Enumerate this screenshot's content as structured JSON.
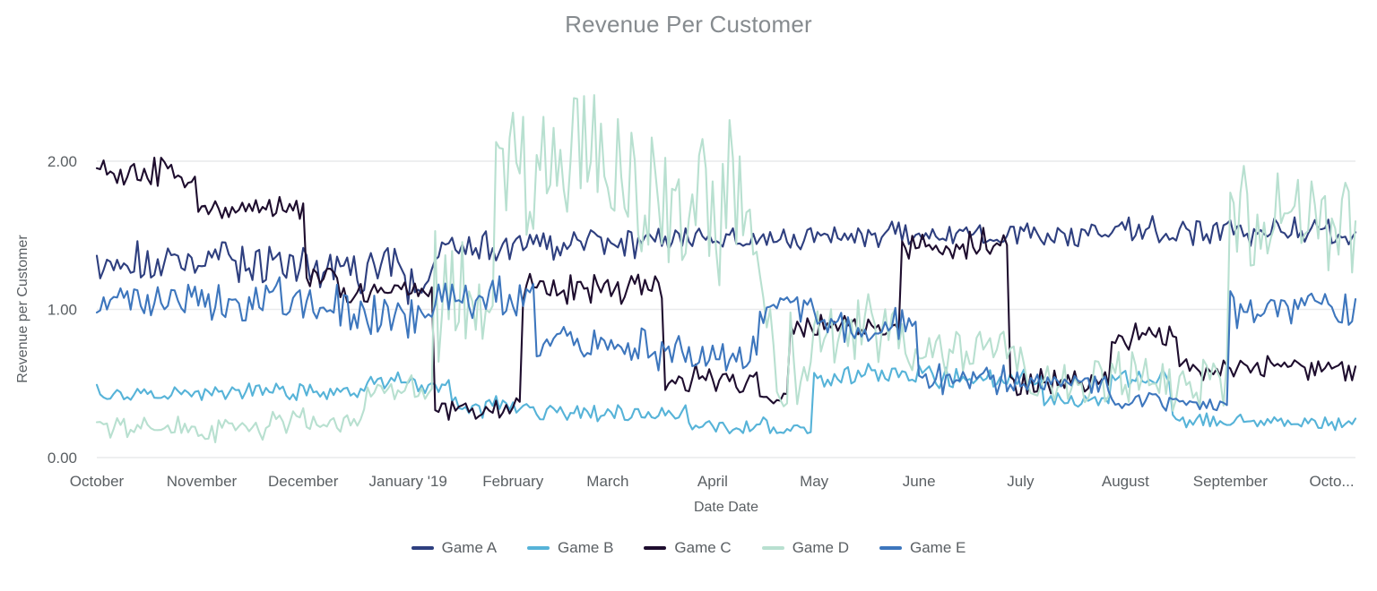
{
  "chart_data": {
    "type": "line",
    "title": "Revenue Per Customer",
    "xlabel": "Date Date",
    "ylabel": "Revenue per Customer",
    "grid": true,
    "legend_position": "bottom",
    "ylim": [
      0.0,
      2.8
    ],
    "yticks": [
      0.0,
      1.0,
      2.0
    ],
    "ytick_labels": [
      "0.00",
      "1.00",
      "2.00"
    ],
    "x_tick_labels": [
      "October",
      "November",
      "December",
      "January '19",
      "February",
      "March",
      "April",
      "May",
      "June",
      "July",
      "August",
      "September",
      "Octo..."
    ],
    "x_tick_positions": [
      0,
      31,
      61,
      92,
      123,
      151,
      182,
      212,
      243,
      273,
      304,
      335,
      365
    ],
    "x_range_days": [
      0,
      372
    ],
    "n_points": 373,
    "series": [
      {
        "name": "Game A",
        "color": "#2e3f7f",
        "segments": [
          {
            "from": 0,
            "to": 30,
            "level": 1.3,
            "noise": 0.11
          },
          {
            "from": 30,
            "to": 62,
            "level": 1.32,
            "noise": 0.11
          },
          {
            "from": 62,
            "to": 92,
            "level": 1.26,
            "noise": 0.12
          },
          {
            "from": 92,
            "to": 100,
            "level": 1.18,
            "noise": 0.1
          },
          {
            "from": 100,
            "to": 122,
            "level": 1.42,
            "noise": 0.09
          },
          {
            "from": 122,
            "to": 160,
            "level": 1.44,
            "noise": 0.08
          },
          {
            "from": 160,
            "to": 210,
            "level": 1.48,
            "noise": 0.07
          },
          {
            "from": 210,
            "to": 250,
            "level": 1.5,
            "noise": 0.07
          },
          {
            "from": 250,
            "to": 300,
            "level": 1.5,
            "noise": 0.07
          },
          {
            "from": 300,
            "to": 340,
            "level": 1.53,
            "noise": 0.07
          },
          {
            "from": 340,
            "to": 373,
            "level": 1.52,
            "noise": 0.07
          }
        ]
      },
      {
        "name": "Game B",
        "color": "#56b3d8",
        "segments": [
          {
            "from": 0,
            "to": 45,
            "level": 0.44,
            "noise": 0.05
          },
          {
            "from": 45,
            "to": 80,
            "level": 0.45,
            "noise": 0.05
          },
          {
            "from": 80,
            "to": 95,
            "level": 0.52,
            "noise": 0.05
          },
          {
            "from": 95,
            "to": 105,
            "level": 0.47,
            "noise": 0.05
          },
          {
            "from": 105,
            "to": 130,
            "level": 0.34,
            "noise": 0.05
          },
          {
            "from": 130,
            "to": 175,
            "level": 0.3,
            "noise": 0.05
          },
          {
            "from": 175,
            "to": 200,
            "level": 0.22,
            "noise": 0.04
          },
          {
            "from": 200,
            "to": 212,
            "level": 0.19,
            "noise": 0.03
          },
          {
            "from": 212,
            "to": 245,
            "level": 0.55,
            "noise": 0.07
          },
          {
            "from": 245,
            "to": 280,
            "level": 0.53,
            "noise": 0.06
          },
          {
            "from": 280,
            "to": 300,
            "level": 0.38,
            "noise": 0.05
          },
          {
            "from": 300,
            "to": 318,
            "level": 0.55,
            "noise": 0.05
          },
          {
            "from": 318,
            "to": 373,
            "level": 0.24,
            "noise": 0.04
          }
        ]
      },
      {
        "name": "Game C",
        "color": "#1e0d2e",
        "segments": [
          {
            "from": 0,
            "to": 30,
            "level": 1.92,
            "noise": 0.09
          },
          {
            "from": 30,
            "to": 62,
            "level": 1.68,
            "noise": 0.08
          },
          {
            "from": 62,
            "to": 72,
            "level": 1.22,
            "noise": 0.07
          },
          {
            "from": 72,
            "to": 100,
            "level": 1.12,
            "noise": 0.07
          },
          {
            "from": 100,
            "to": 126,
            "level": 0.33,
            "noise": 0.06
          },
          {
            "from": 126,
            "to": 168,
            "level": 1.15,
            "noise": 0.08
          },
          {
            "from": 168,
            "to": 196,
            "level": 0.52,
            "noise": 0.08
          },
          {
            "from": 196,
            "to": 205,
            "level": 0.4,
            "noise": 0.05
          },
          {
            "from": 205,
            "to": 238,
            "level": 0.88,
            "noise": 0.07
          },
          {
            "from": 238,
            "to": 270,
            "level": 1.43,
            "noise": 0.08
          },
          {
            "from": 270,
            "to": 300,
            "level": 0.52,
            "noise": 0.07
          },
          {
            "from": 300,
            "to": 320,
            "level": 0.82,
            "noise": 0.08
          },
          {
            "from": 320,
            "to": 373,
            "level": 0.6,
            "noise": 0.06
          }
        ]
      },
      {
        "name": "Game D",
        "color": "#b8e0d0",
        "segments": [
          {
            "from": 0,
            "to": 50,
            "level": 0.19,
            "noise": 0.06
          },
          {
            "from": 50,
            "to": 80,
            "level": 0.24,
            "noise": 0.07
          },
          {
            "from": 80,
            "to": 100,
            "level": 0.45,
            "noise": 0.08
          },
          {
            "from": 100,
            "to": 118,
            "level": 1.1,
            "noise": 0.35
          },
          {
            "from": 118,
            "to": 160,
            "level": 2.0,
            "noise": 0.42
          },
          {
            "from": 160,
            "to": 196,
            "level": 1.7,
            "noise": 0.45
          },
          {
            "from": 196,
            "to": 212,
            "level": 0.7,
            "noise": 0.35
          },
          {
            "from": 212,
            "to": 240,
            "level": 0.85,
            "noise": 0.18
          },
          {
            "from": 240,
            "to": 275,
            "level": 0.72,
            "noise": 0.12
          },
          {
            "from": 275,
            "to": 300,
            "level": 0.5,
            "noise": 0.15
          },
          {
            "from": 300,
            "to": 335,
            "level": 0.5,
            "noise": 0.15
          },
          {
            "from": 335,
            "to": 373,
            "level": 1.62,
            "noise": 0.32
          }
        ]
      },
      {
        "name": "Game E",
        "color": "#3d76bd",
        "segments": [
          {
            "from": 0,
            "to": 40,
            "level": 1.06,
            "noise": 0.11
          },
          {
            "from": 40,
            "to": 75,
            "level": 1.05,
            "noise": 0.12
          },
          {
            "from": 75,
            "to": 100,
            "level": 0.96,
            "noise": 0.13
          },
          {
            "from": 100,
            "to": 130,
            "level": 1.08,
            "noise": 0.1
          },
          {
            "from": 130,
            "to": 165,
            "level": 0.76,
            "noise": 0.09
          },
          {
            "from": 165,
            "to": 196,
            "level": 0.7,
            "noise": 0.09
          },
          {
            "from": 196,
            "to": 212,
            "level": 1.02,
            "noise": 0.1
          },
          {
            "from": 212,
            "to": 243,
            "level": 0.88,
            "noise": 0.09
          },
          {
            "from": 243,
            "to": 270,
            "level": 0.52,
            "noise": 0.08
          },
          {
            "from": 270,
            "to": 300,
            "level": 0.5,
            "noise": 0.07
          },
          {
            "from": 300,
            "to": 318,
            "level": 0.38,
            "noise": 0.05
          },
          {
            "from": 318,
            "to": 335,
            "level": 0.36,
            "noise": 0.05
          },
          {
            "from": 335,
            "to": 373,
            "level": 1.02,
            "noise": 0.1
          }
        ]
      }
    ]
  },
  "legend": {
    "items": [
      {
        "label": "Game A",
        "color": "#2e3f7f"
      },
      {
        "label": "Game B",
        "color": "#56b3d8"
      },
      {
        "label": "Game C",
        "color": "#1e0d2e"
      },
      {
        "label": "Game D",
        "color": "#b8e0d0"
      },
      {
        "label": "Game E",
        "color": "#3d76bd"
      }
    ]
  }
}
